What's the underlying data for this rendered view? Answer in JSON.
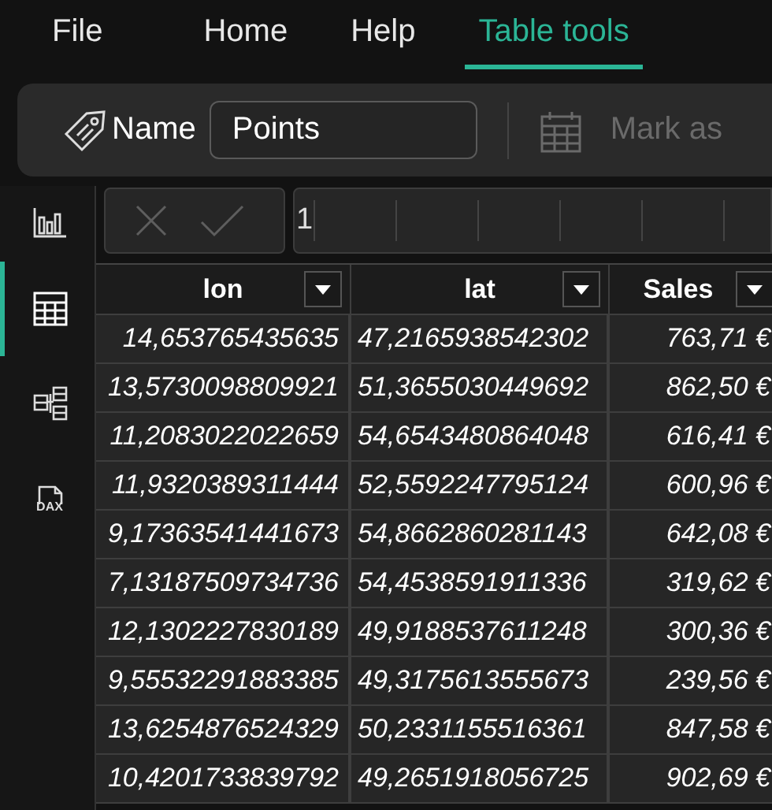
{
  "menu_tabs": [
    {
      "label": "File",
      "selected": false
    },
    {
      "label": "Home",
      "selected": false
    },
    {
      "label": "Help",
      "selected": false
    },
    {
      "label": "Table tools",
      "selected": true
    }
  ],
  "ribbon": {
    "name_label": "Name",
    "name_value": "Points",
    "mark_as": {
      "label": "Mark as",
      "disabled": true
    }
  },
  "sidebar": {
    "items": [
      {
        "kind": "report",
        "selected": false
      },
      {
        "kind": "table",
        "selected": true
      },
      {
        "kind": "model",
        "selected": false
      },
      {
        "kind": "dax",
        "selected": false,
        "label": "DAX"
      }
    ]
  },
  "formula_bar": {
    "value": "1",
    "cancel_disabled": true,
    "commit_disabled": true
  },
  "table": {
    "columns": [
      "lon",
      "lat",
      "Sales"
    ],
    "rows": [
      [
        "14,653765435635",
        "47,2165938542302",
        "763,71 €"
      ],
      [
        "13,5730098809921",
        "51,3655030449692",
        "862,50 €"
      ],
      [
        "11,2083022022659",
        "54,6543480864048",
        "616,41 €"
      ],
      [
        "11,9320389311444",
        "52,5592247795124",
        "600,96 €"
      ],
      [
        "9,17363541441673",
        "54,8662860281143",
        "642,08 €"
      ],
      [
        "7,13187509734736",
        "54,4538591911336",
        "319,62 €"
      ],
      [
        "12,1302227830189",
        "49,9188537611248",
        "300,36 €"
      ],
      [
        "9,55532291883385",
        "49,3175613555673",
        "239,56 €"
      ],
      [
        "13,6254876524329",
        "50,2331155516361",
        "847,58 €"
      ],
      [
        "10,4201733839792",
        "49,2651918056725",
        "902,69 €"
      ]
    ]
  }
}
